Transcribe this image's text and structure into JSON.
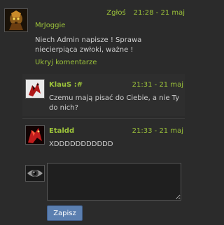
{
  "main_comment": {
    "report_label": "Zgłoś",
    "time": "21:28 - 21 maj",
    "author": "MrJoggie",
    "text": "Niech Admin napisze ! Sprawa niecierpiąca zwłoki, ważne !",
    "hide_label": "Ukryj komentarze",
    "avatar_icon": "warrior-avatar-icon"
  },
  "replies": [
    {
      "author": "KlauS :#",
      "time": "21:31 - 21 maj",
      "text": "Czemu mają pisać do Ciebie, a nie Ty do nich?",
      "avatar_icon": "red-figure-avatar-icon"
    },
    {
      "author": "Etaldd",
      "time": "21:33 - 21 maj",
      "text": "XDDDDDDDDDDD",
      "avatar_icon": "red-figure-avatar-icon"
    }
  ],
  "compose": {
    "input_value": "",
    "submit_label": "Zapisz",
    "avatar_icon": "eye-avatar-icon"
  },
  "colors": {
    "background": "#2b2b2b",
    "accent_green": "#9dc43a",
    "button_blue": "#5b7fb0"
  }
}
